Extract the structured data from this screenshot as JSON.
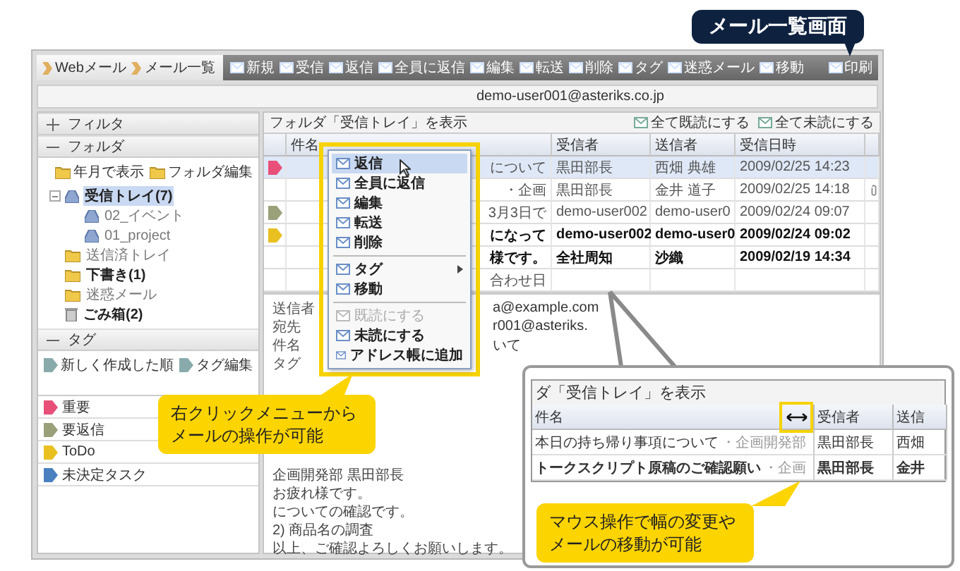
{
  "badge": "メール一覧画面",
  "breadcrumb": [
    "Webメール",
    "メール一覧"
  ],
  "toolbar": [
    {
      "label": "新規"
    },
    {
      "label": "受信"
    },
    {
      "label": "返信"
    },
    {
      "label": "全員に返信"
    },
    {
      "label": "編集"
    },
    {
      "label": "転送"
    },
    {
      "label": "削除"
    },
    {
      "label": "タグ"
    },
    {
      "label": "迷惑メール"
    },
    {
      "label": "移動"
    },
    {
      "label": "印刷"
    }
  ],
  "account": "demo-user001@asteriks.co.jp",
  "sidebar": {
    "filter": {
      "title": "フィルタ",
      "expanded": false
    },
    "folders": {
      "title": "フォルダ",
      "expanded": true,
      "actions": [
        "年月で表示",
        "フォルダ編集"
      ],
      "items": [
        {
          "kind": "inbox",
          "label": "受信トレイ(7)",
          "selected": true,
          "unread": true,
          "expanded": true,
          "children": [
            {
              "kind": "inbox",
              "label": "02_イベント",
              "selected": false,
              "unread": false
            },
            {
              "kind": "inbox",
              "label": "01_project",
              "selected": false,
              "unread": false
            }
          ]
        },
        {
          "kind": "folder",
          "label": "送信済トレイ",
          "selected": false,
          "unread": false
        },
        {
          "kind": "folder",
          "label": "下書き(1)",
          "selected": false,
          "unread": true
        },
        {
          "kind": "folder",
          "label": "迷惑メール",
          "selected": false,
          "unread": false
        },
        {
          "kind": "trash",
          "label": "ごみ箱(2)",
          "selected": false,
          "unread": true
        }
      ]
    },
    "tags": {
      "title": "タグ",
      "expanded": true,
      "actions": [
        "新しく作成した順",
        "タグ編集"
      ],
      "items": [
        {
          "label": "重要",
          "color": "#e8507a"
        },
        {
          "label": "要返信",
          "color": "#9aa07a"
        },
        {
          "label": "ToDo",
          "color": "#e8c020"
        },
        {
          "label": "未決定タスク",
          "color": "#4a80c0"
        }
      ]
    }
  },
  "mail_list": {
    "heading": "フォルダ「受信トレイ」を表示",
    "actions": [
      "全て既読にする",
      "全て未読にする"
    ],
    "columns": [
      "件名",
      "受信者",
      "送信者",
      "受信日時"
    ],
    "rows": [
      {
        "subject": "について",
        "to": "黒田部長",
        "from": "西畑 典雄",
        "date": "2009/02/25 14:23",
        "selected": true,
        "unread": false,
        "attachment": false,
        "color": "#e8507a"
      },
      {
        "subject": "・企画",
        "to": "黒田部長",
        "from": "金井 道子",
        "date": "2009/02/25 14:18",
        "selected": false,
        "unread": false,
        "attachment": true
      },
      {
        "subject": "3月3日で",
        "to": "demo-user002",
        "from": "demo-user0",
        "date": "2009/02/24 09:07",
        "selected": false,
        "unread": false,
        "attachment": false,
        "color": "#9aa07a"
      },
      {
        "subject": "になって",
        "to": "demo-user002",
        "from": "demo-user0",
        "date": "2009/02/24 09:02",
        "selected": false,
        "unread": true,
        "attachment": false,
        "color": "#e8c020"
      },
      {
        "subject": "様です。",
        "to": "全社周知",
        "from": "沙織",
        "date": "2009/02/19 14:34",
        "selected": false,
        "unread": true,
        "attachment": false
      },
      {
        "subject": "合わせ日",
        "selected": false,
        "unread": false,
        "attachment": false
      }
    ]
  },
  "context_menu": {
    "items": [
      {
        "kind": "item",
        "label": "返信",
        "selected": true,
        "disabled": false
      },
      {
        "kind": "item",
        "label": "全員に返信",
        "selected": false,
        "disabled": false
      },
      {
        "kind": "item",
        "label": "編集",
        "selected": false,
        "disabled": false
      },
      {
        "kind": "item",
        "label": "転送",
        "selected": false,
        "disabled": false
      },
      {
        "kind": "item",
        "label": "削除",
        "selected": false,
        "disabled": false
      },
      {
        "kind": "separator"
      },
      {
        "kind": "submenu",
        "label": "タグ",
        "selected": false,
        "disabled": false
      },
      {
        "kind": "item",
        "label": "移動",
        "selected": false,
        "disabled": false
      },
      {
        "kind": "separator"
      },
      {
        "kind": "item",
        "label": "既読にする",
        "selected": false,
        "disabled": true
      },
      {
        "kind": "item",
        "label": "未読にする",
        "selected": false,
        "disabled": false
      },
      {
        "kind": "item",
        "label": "アドレス帳に追加",
        "selected": false,
        "disabled": false
      }
    ]
  },
  "preview": {
    "fields": [
      {
        "label": "送信者",
        "value": "a@example.com"
      },
      {
        "label": "宛先",
        "value": "r001@asteriks."
      },
      {
        "label": "件名",
        "value": "いて"
      },
      {
        "label": "タグ"
      }
    ],
    "body": [
      "企画開発部 黒田部長",
      "お疲れ様です。",
      "についての確認です。",
      "2) 商品名の調査",
      "以上、ご確認よろしくお願いします。"
    ]
  },
  "menu_callout": "右クリックメニューからメールの操作が可能",
  "zoom_inset": {
    "heading": "ダ「受信トレイ」を表示",
    "columns": [
      "件名",
      "受信者",
      "送信"
    ],
    "rows": [
      {
        "subject": "本日の持ち帰り事項について",
        "dept": "・企画開発部",
        "to": "黒田部長",
        "from": "西畑",
        "unread": false
      },
      {
        "subject": "トークスクリプト原稿のご確認願い",
        "dept": "・企画",
        "to": "黒田部長",
        "from": "金井",
        "unread": true
      }
    ],
    "callout": "マウス操作で幅の変更やメールの移動が可能"
  }
}
